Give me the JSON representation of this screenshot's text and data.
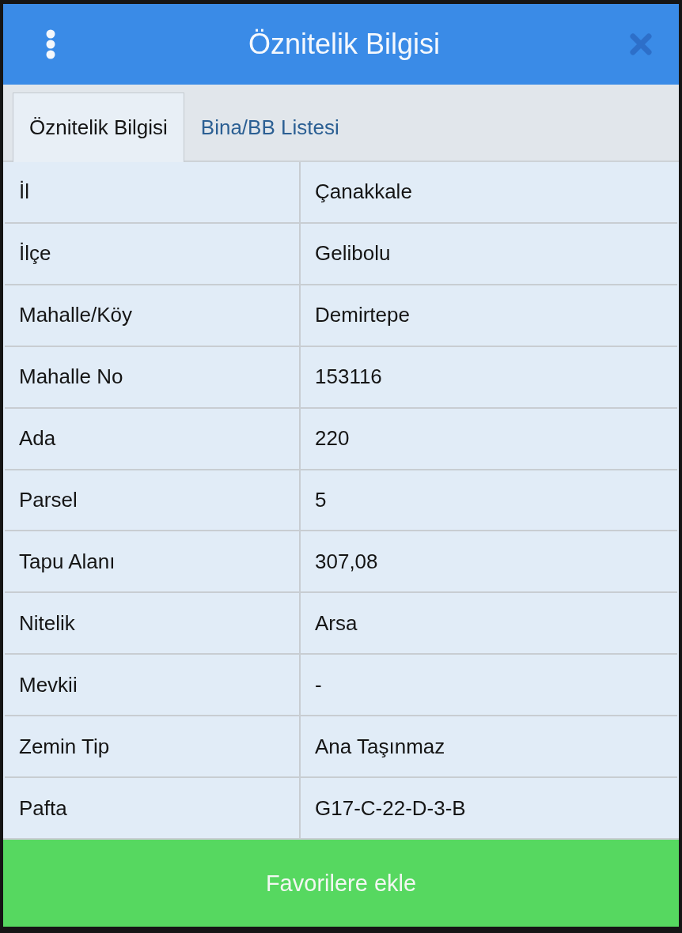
{
  "header": {
    "title": "Öznitelik Bilgisi"
  },
  "tabs": [
    {
      "label": "Öznitelik Bilgisi",
      "selected": true
    },
    {
      "label": "Bina/BB Listesi",
      "selected": false
    }
  ],
  "rows": [
    {
      "label": "İl",
      "value": "Çanakkale"
    },
    {
      "label": "İlçe",
      "value": "Gelibolu"
    },
    {
      "label": "Mahalle/Köy",
      "value": "Demirtepe"
    },
    {
      "label": "Mahalle No",
      "value": "153116"
    },
    {
      "label": "Ada",
      "value": "220"
    },
    {
      "label": "Parsel",
      "value": "5"
    },
    {
      "label": "Tapu Alanı",
      "value": "307,08"
    },
    {
      "label": "Nitelik",
      "value": "Arsa"
    },
    {
      "label": "Mevkii",
      "value": "-"
    },
    {
      "label": "Zemin Tip",
      "value": "Ana Taşınmaz"
    },
    {
      "label": "Pafta",
      "value": "G17-C-22-D-3-B"
    }
  ],
  "button": {
    "label": "Favorilere ekle"
  }
}
